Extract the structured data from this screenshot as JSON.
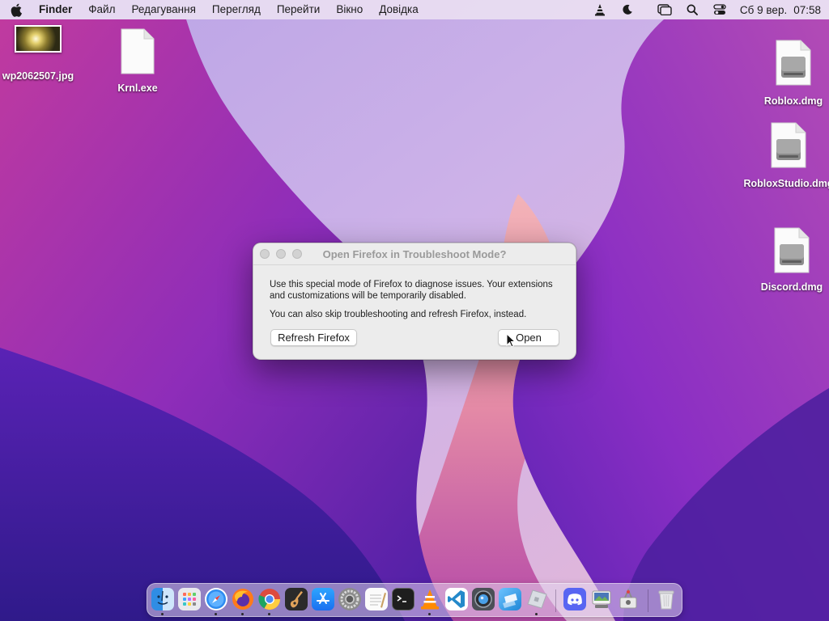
{
  "menubar": {
    "app_name": "Finder",
    "items": [
      "Файл",
      "Редагування",
      "Перегляд",
      "Перейти",
      "Вікно",
      "Довідка"
    ],
    "status_icons": [
      "vlc-cone-icon",
      "moon-icon",
      "screen-mirroring-icon",
      "search-icon",
      "control-center-icon"
    ],
    "date": "Сб 9 вер.",
    "time": "07:58"
  },
  "desktop": {
    "icons": [
      {
        "label": "wp2062507.jpg",
        "icon": "image-thumbnail-icon"
      },
      {
        "label": "Krnl.exe",
        "icon": "document-icon"
      },
      {
        "label": "Roblox.dmg",
        "icon": "disk-image-icon"
      },
      {
        "label": "RobloxStudio.dmg",
        "icon": "disk-image-icon"
      },
      {
        "label": "Discord.dmg",
        "icon": "disk-image-icon"
      }
    ]
  },
  "dialog": {
    "title": "Open Firefox in Troubleshoot Mode?",
    "message1": "Use this special mode of Firefox to diagnose issues. Your extensions and customizations will be temporarily disabled.",
    "message2": "You can also skip troubleshooting and refresh Firefox, instead.",
    "refresh_label": "Refresh Firefox",
    "open_label": "Open"
  },
  "dock": {
    "apps": [
      {
        "name": "finder",
        "running": true
      },
      {
        "name": "launchpad",
        "running": false
      },
      {
        "name": "safari",
        "running": true
      },
      {
        "name": "firefox",
        "running": true
      },
      {
        "name": "chrome",
        "running": true
      },
      {
        "name": "garageband",
        "running": false
      },
      {
        "name": "app-store",
        "running": false
      },
      {
        "name": "system-preferences",
        "running": false
      },
      {
        "name": "textedit",
        "running": false
      },
      {
        "name": "terminal",
        "running": false
      },
      {
        "name": "vlc",
        "running": true
      },
      {
        "name": "vscode",
        "running": false
      },
      {
        "name": "camera",
        "running": false
      },
      {
        "name": "roblox",
        "running": false
      },
      {
        "name": "roblox-studio",
        "running": true
      },
      {
        "name": "discord",
        "running": false
      },
      {
        "name": "preview",
        "running": false
      },
      {
        "name": "disk-utility",
        "running": false
      },
      {
        "name": "trash",
        "running": false
      }
    ]
  },
  "colors": {
    "accent": "#8a3fd1",
    "dialog_bg": "#ececec",
    "menubar_bg": "#ece2f2"
  }
}
